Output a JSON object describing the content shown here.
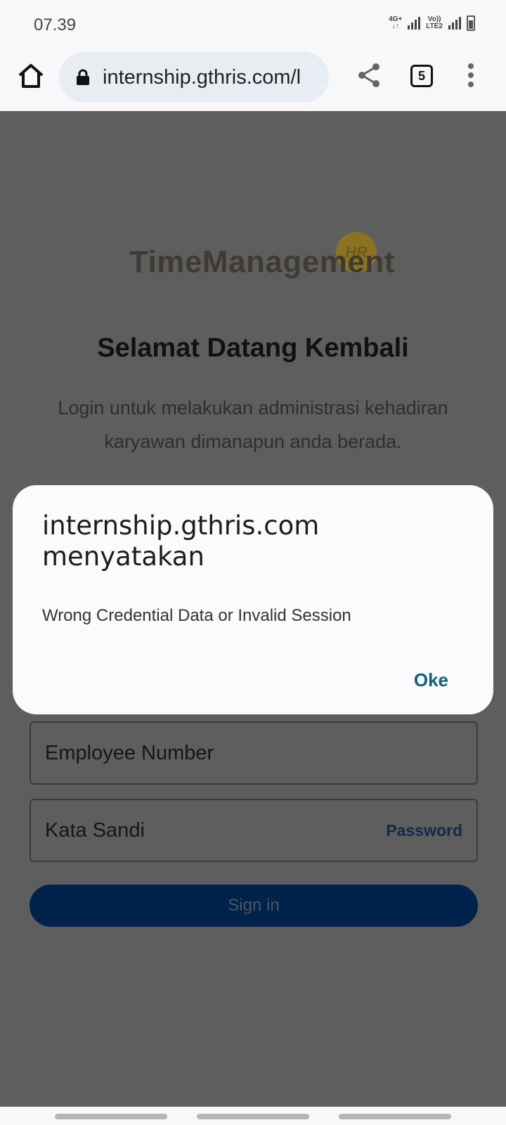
{
  "status_bar": {
    "time": "07.39",
    "network1": "4G+",
    "network2_top": "Vo))",
    "network2_bottom": "LTE2"
  },
  "browser": {
    "url": "internship.gthris.com/l",
    "tab_count": "5"
  },
  "page": {
    "logo_text": "TimeManagement",
    "logo_badge": "HR",
    "title": "Selamat Datang Kembali",
    "subtitle": "Login untuk melakukan administrasi kehadiran karyawan dimanapun anda berada.",
    "employee_field_label": "Employee Number",
    "password_field_label": "Kata Sandi",
    "password_toggle": "Password",
    "signin_label": "Sign in"
  },
  "dialog": {
    "title": "internship.gthris.com menyatakan",
    "message": "Wrong Credential Data or Invalid Session",
    "ok_label": "Oke"
  },
  "colors": {
    "overlay": "#5e5e5e",
    "signin": "#01234b",
    "dialog_accent": "#0f6478"
  }
}
